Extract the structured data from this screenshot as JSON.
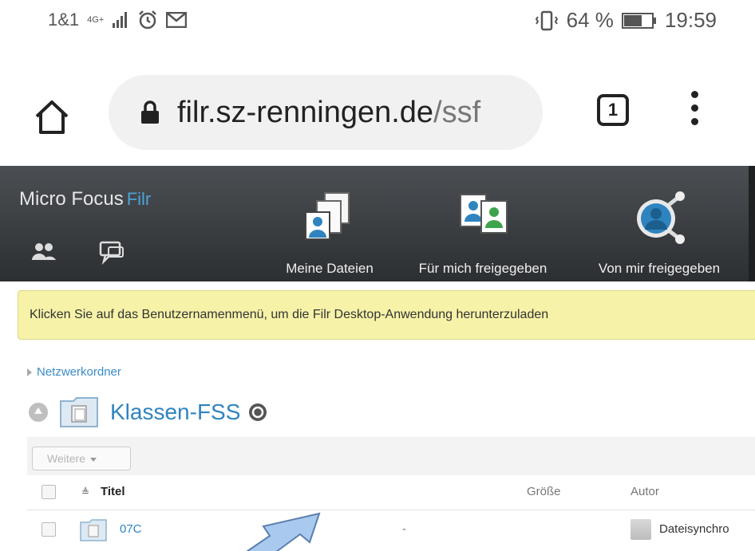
{
  "status_bar": {
    "carrier": "1&1",
    "network": "4G+",
    "battery": "64 %",
    "time": "19:59"
  },
  "browser": {
    "url_domain": "filr.sz-renningen.de",
    "url_path": "/ssf",
    "tab_count": "1"
  },
  "header": {
    "brand": "Micro Focus",
    "brand_product": "Filr",
    "nav": [
      {
        "label": "Meine Dateien",
        "icon": "my-files-icon"
      },
      {
        "label": "Für mich freigegeben",
        "icon": "shared-with-me-icon"
      },
      {
        "label": "Von mir freigegeben",
        "icon": "shared-by-me-icon"
      }
    ]
  },
  "notice": {
    "text": "Klicken Sie auf das Benutzernamenmenü, um die Filr Desktop-Anwendung herunterzuladen"
  },
  "breadcrumb": {
    "label": "Netzwerkordner"
  },
  "folder": {
    "title": "Klassen-FSS"
  },
  "toolbar": {
    "more_label": "Weitere"
  },
  "table": {
    "columns": {
      "title": "Titel",
      "size": "Größe",
      "author": "Autor"
    },
    "rows": [
      {
        "name": "07C",
        "size": "-",
        "author": "Dateisynchro"
      }
    ]
  },
  "colors": {
    "header_dark": "#2c2f32",
    "accent_blue": "#2f84c0",
    "notice_yellow": "#f6f2a8"
  }
}
